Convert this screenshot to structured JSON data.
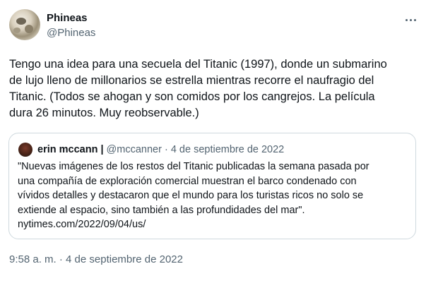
{
  "author": {
    "display_name": "Phineas",
    "handle": "@Phineas",
    "avatar_icon": "leopard-avatar"
  },
  "tweet": {
    "text": "Tengo una idea para una secuela del Titanic (1997), donde un submarino\nde lujo lleno de millonarios se estrella mientras recorre el naufragio del\nTitanic. (Todos se ahogan y son comidos por los cangrejos. La película\ndura 26 minutos. Muy reobservable.)",
    "timestamp": "9:58 a. m. · 4 de septiembre de 2022"
  },
  "quoted": {
    "display_name": "erin mccann",
    "separator": "|",
    "handle": "@mccanner",
    "date": "· 4 de septiembre de 2022",
    "text": "\"Nuevas imágenes de los restos del Titanic publicadas la semana pasada por\nuna compañía de exploración comercial muestran el barco condenado con\nvívidos detalles y destacaron que el mundo para los turistas ricos no solo se\nextiende al espacio, sino también a las profundidades del mar\".\nnytimes.com/2022/09/04/us/"
  },
  "colors": {
    "primary_text": "#0f1419",
    "secondary_text": "#536471",
    "border": "#cfd9de"
  },
  "icons": {
    "more": "more-horizontal-icon"
  }
}
